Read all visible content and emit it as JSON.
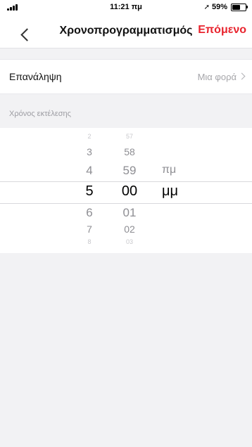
{
  "status_bar": {
    "time": "11:21 πμ",
    "battery": "59%",
    "battery_level": 0.59,
    "location_icon": "location-arrow-icon",
    "signal_icon": "cellular-signal-icon"
  },
  "nav": {
    "title": "Χρονοπρογραμματισμός",
    "next_label": "Επόμενο",
    "back_icon": "chevron-left-icon",
    "accent_color": "#e8232d"
  },
  "repeat": {
    "label": "Επανάληψη",
    "value": "Μια φορά"
  },
  "section": {
    "execution_time_label": "Χρόνος εκτέλεσης"
  },
  "time_picker": {
    "hours": [
      "2",
      "3",
      "4",
      "5",
      "6",
      "7",
      "8"
    ],
    "minutes": [
      "57",
      "58",
      "59",
      "00",
      "01",
      "02",
      "03"
    ],
    "periods": [
      "πμ",
      "μμ"
    ],
    "selected_hour": "5",
    "selected_minute": "00",
    "selected_period": "μμ"
  }
}
